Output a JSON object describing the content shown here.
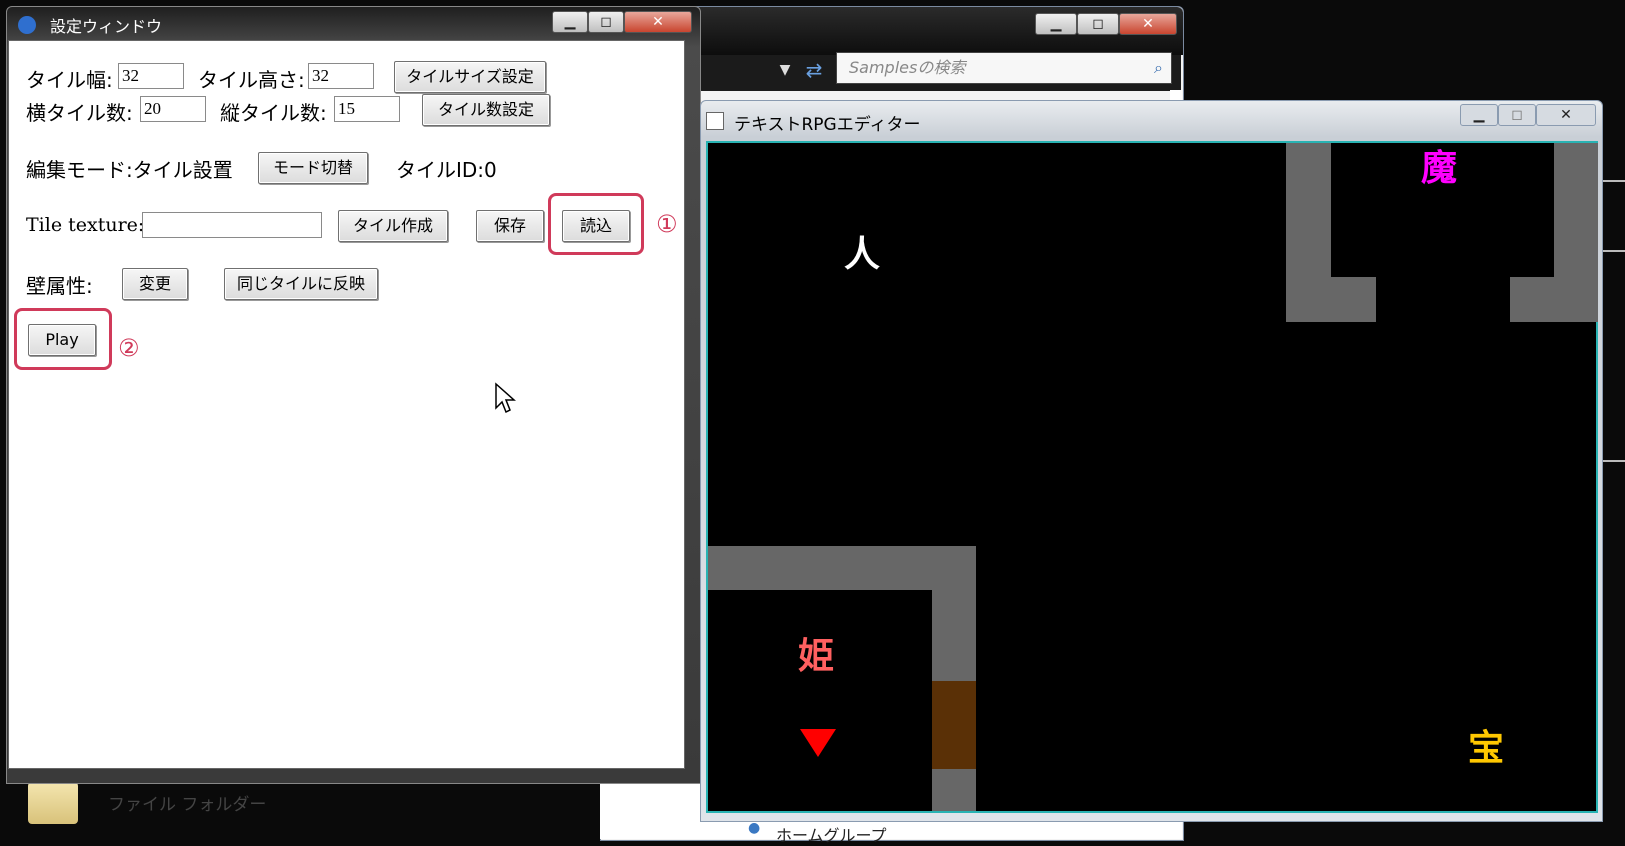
{
  "explorer": {
    "search_placeholder": "Samplesの検索",
    "folder_type": "ファイル フォルダー",
    "nav_item": "ホームグループ",
    "caption_buttons": [
      "▁",
      "◻",
      "✕"
    ]
  },
  "settings": {
    "title": "設定ウィンドウ",
    "caption_buttons": [
      "▁",
      "◻",
      "✕"
    ],
    "tile_width_label": "タイル幅:",
    "tile_width_value": "32",
    "tile_height_label": "タイル高さ:",
    "tile_height_value": "32",
    "set_tile_size_button": "タイルサイズ設定",
    "h_tiles_label": "横タイル数:",
    "h_tiles_value": "20",
    "v_tiles_label": "縦タイル数:",
    "v_tiles_value": "15",
    "set_tile_count_button": "タイル数設定",
    "edit_mode_label": "編集モード:タイル設置",
    "mode_toggle_button": "モード切替",
    "tile_id_label": "タイルID:0",
    "tile_texture_label": "Tile texture:",
    "tile_texture_value": "",
    "create_tile_button": "タイル作成",
    "save_button": "保存",
    "load_button": "読込",
    "wall_attr_label": "壁属性:",
    "change_button": "変更",
    "apply_same_button": "同じタイルに反映",
    "play_button": "Play",
    "annotation_1": "①",
    "annotation_2": "②"
  },
  "editor": {
    "title": "テキストRPGエディター",
    "caption_buttons": [
      "▁",
      "◻",
      "✕"
    ],
    "map": {
      "player_glyph": "人",
      "demon_glyph": "魔",
      "princess_glyph": "姫",
      "treasure_glyph": "宝"
    },
    "colors": {
      "background": "#000000",
      "wall": "#676767",
      "door": "#5a3006",
      "player": "#ffffff",
      "demon": "#ff00ff",
      "princess": "#ff6060",
      "treasure": "#ffc800",
      "marker": "#ff0000"
    }
  }
}
